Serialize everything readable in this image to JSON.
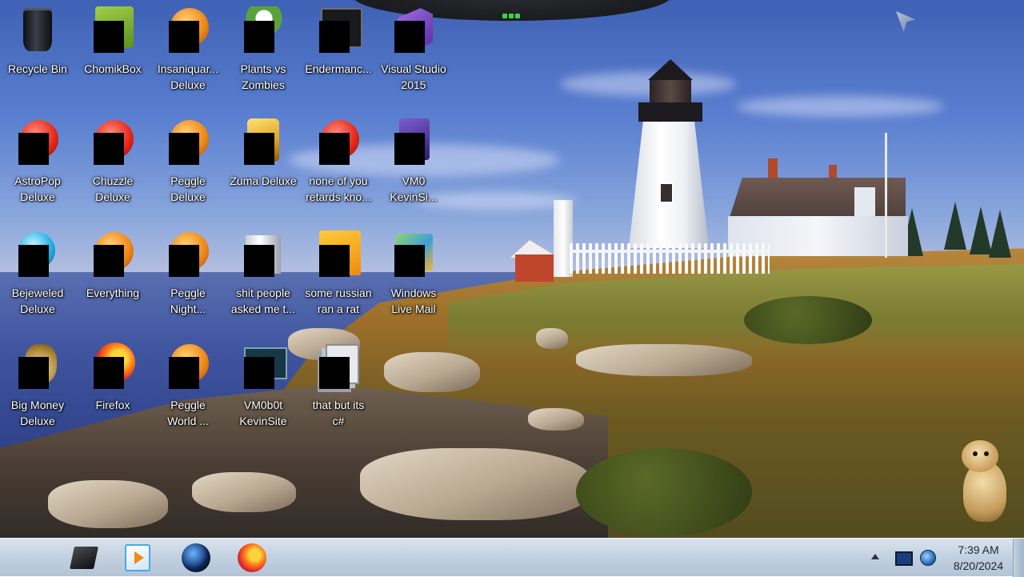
{
  "desktop": {
    "icons": [
      {
        "label": "Recycle Bin",
        "icon": "recycle-bin-icon",
        "art": "art-bin"
      },
      {
        "label": "ChomikBox",
        "icon": "chomikbox-icon",
        "art": "art-box"
      },
      {
        "label": "Insaniquar...\nDeluxe",
        "icon": "insaniquarium-icon",
        "art": "art-orange-ball"
      },
      {
        "label": "Plants vs\nZombies",
        "icon": "plants-vs-zombies-icon",
        "art": "art-plant"
      },
      {
        "label": "Endermanc...",
        "icon": "endermanch-icon",
        "art": "art-terminal"
      },
      {
        "label": "Visual Studio\n2015",
        "icon": "visual-studio-icon",
        "art": "art-vs"
      },
      {
        "label": "AstroPop\nDeluxe",
        "icon": "astropop-icon",
        "art": "art-red-ball"
      },
      {
        "label": "Chuzzle\nDeluxe",
        "icon": "chuzzle-icon",
        "art": "art-red-ball"
      },
      {
        "label": "Peggle\nDeluxe",
        "icon": "peggle-icon",
        "art": "art-orange-ball"
      },
      {
        "label": "Zuma Deluxe",
        "icon": "zuma-icon",
        "art": "art-gold"
      },
      {
        "label": "none of you\nretards kno...",
        "icon": "red-ball-icon",
        "art": "art-red-ball"
      },
      {
        "label": "VM0\nKevinSi...",
        "icon": "vm-icon",
        "art": "art-vm"
      },
      {
        "label": "Bejeweled\nDeluxe",
        "icon": "bejeweled-icon",
        "art": "art-blue-gem"
      },
      {
        "label": "Everything",
        "icon": "everything-search-icon",
        "art": "art-orange-ball"
      },
      {
        "label": "Peggle\nNight...",
        "icon": "peggle-nights-icon",
        "art": "art-orange-ball"
      },
      {
        "label": "shit people\nasked me t...",
        "icon": "folder-icon",
        "art": "art-folder"
      },
      {
        "label": "some russian\nran a rat",
        "icon": "letter-e-icon",
        "art": "art-letter-e"
      },
      {
        "label": "Windows\nLive Mail",
        "icon": "windows-live-mail-icon",
        "art": "art-mail"
      },
      {
        "label": "Big Money\nDeluxe",
        "icon": "big-money-icon",
        "art": "art-moneybag"
      },
      {
        "label": "Firefox",
        "icon": "firefox-icon",
        "art": "art-firefox"
      },
      {
        "label": "Peggle\nWorld ...",
        "icon": "peggle-world-icon",
        "art": "art-orange-ball"
      },
      {
        "label": "VM0b0t\nKevinSite",
        "icon": "monitor-icon",
        "art": "art-monitor"
      },
      {
        "label": "that but its\nc#",
        "icon": "pages-icon",
        "art": "art-pages"
      }
    ]
  },
  "taskbar": {
    "pinned": [
      {
        "name": "explorer",
        "icon": "file-explorer-icon"
      },
      {
        "name": "media-player",
        "icon": "media-player-icon"
      },
      {
        "name": "globe",
        "icon": "globe-icon"
      },
      {
        "name": "firefox",
        "icon": "firefox-icon"
      }
    ],
    "tray": {
      "time": "7:39 AM",
      "date": "8/20/2024"
    }
  },
  "colors": {
    "taskbar": "#c2d0df",
    "label_text": "#ffffff",
    "redaction": "#000000"
  }
}
